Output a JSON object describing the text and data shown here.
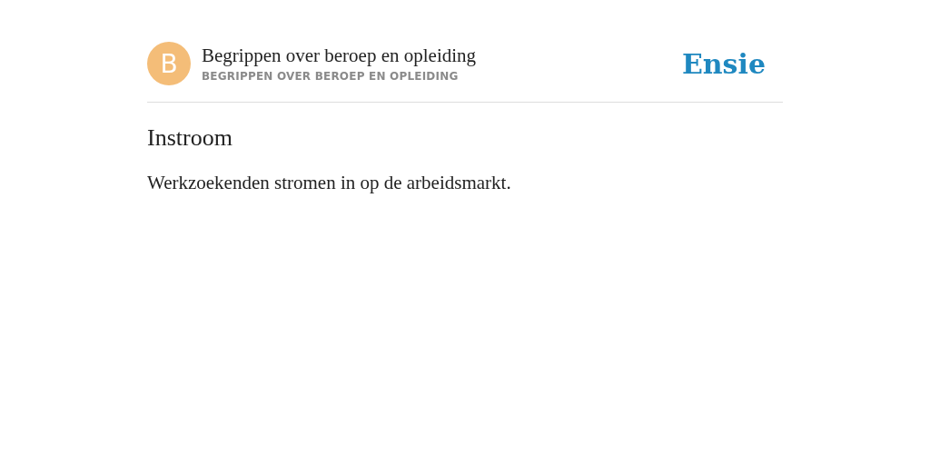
{
  "header": {
    "avatar_letter": "B",
    "title": "Begrippen over beroep en opleiding",
    "subtitle": "BEGRIPPEN OVER BEROEP EN OPLEIDING",
    "logo": "Ensie"
  },
  "article": {
    "heading": "Instroom",
    "body": "Werkzoekenden stromen in op de arbeidsmarkt."
  }
}
